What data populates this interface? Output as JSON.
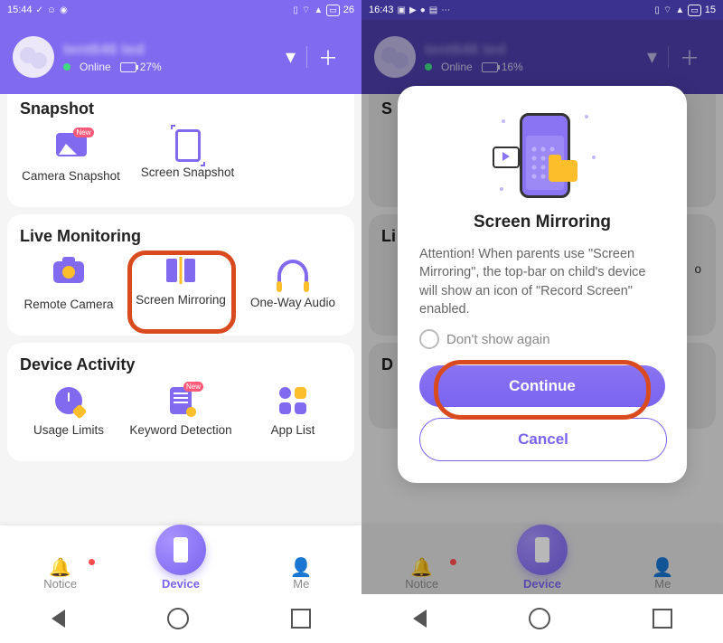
{
  "left": {
    "status": {
      "time": "15:44",
      "battery": "26"
    },
    "user": {
      "name": "tent646 ted",
      "status": "Online",
      "battery": "27%"
    },
    "sections": {
      "snapshot": {
        "title": "Snapshot",
        "items": [
          "Camera Snapshot",
          "Screen Snapshot"
        ]
      },
      "live": {
        "title": "Live Monitoring",
        "items": [
          "Remote Camera",
          "Screen Mirroring",
          "One-Way Audio"
        ]
      },
      "activity": {
        "title": "Device Activity",
        "items": [
          "Usage Limits",
          "Keyword Detection",
          "App List"
        ]
      }
    },
    "tabs": [
      "Notice",
      "Device",
      "Me"
    ]
  },
  "right": {
    "status": {
      "time": "16:43",
      "battery": "15"
    },
    "user": {
      "name": "tent646 ted",
      "status": "Online",
      "battery": "16%"
    },
    "modal": {
      "title": "Screen Mirroring",
      "body": "Attention! When parents use \"Screen Mirroring\", the top-bar on child's device will show an icon of \"Record Screen\" enabled.",
      "checkbox": "Don't show again",
      "continue": "Continue",
      "cancel": "Cancel"
    }
  },
  "badge_new": "New"
}
